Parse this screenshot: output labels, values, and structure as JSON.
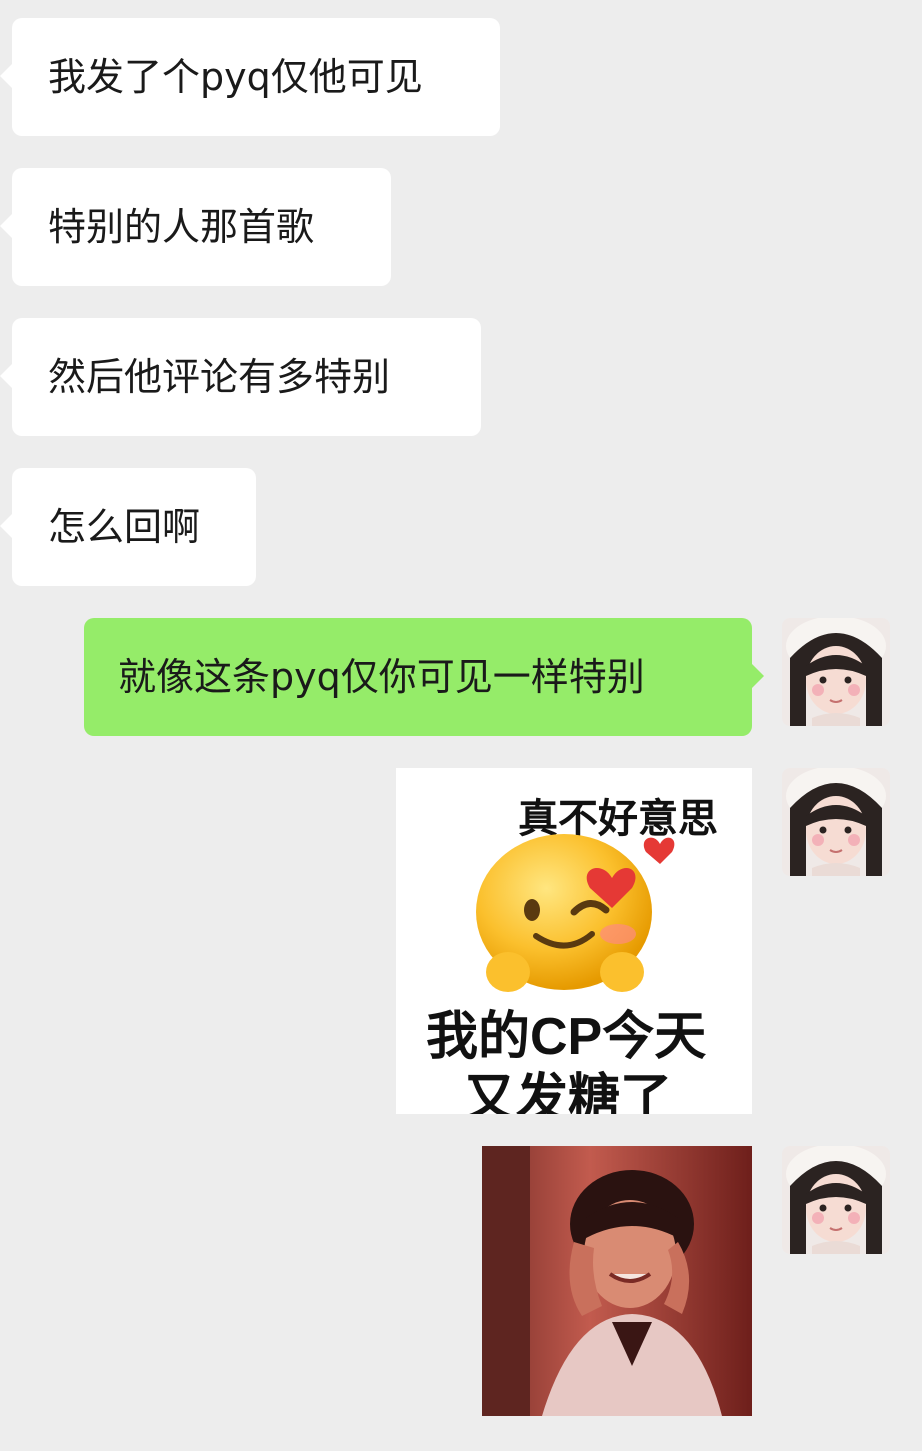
{
  "messages": {
    "incoming": [
      "我发了个pyq仅他可见",
      "特别的人那首歌",
      "然后他评论有多特别",
      "怎么回啊"
    ],
    "outgoing": "就像这条pyq仅你可见一样特别"
  },
  "sticker": {
    "top_text": "真不好意思",
    "bottom_line1": "我的CP今天",
    "bottom_line2": "又发糖了"
  },
  "icons": {
    "avatar": "avatar-girl-icon",
    "emoji": "winking-blushing-face-icon",
    "heart": "heart-icon"
  },
  "colors": {
    "background": "#ededed",
    "incoming_bubble": "#ffffff",
    "outgoing_bubble": "#95ec69"
  }
}
